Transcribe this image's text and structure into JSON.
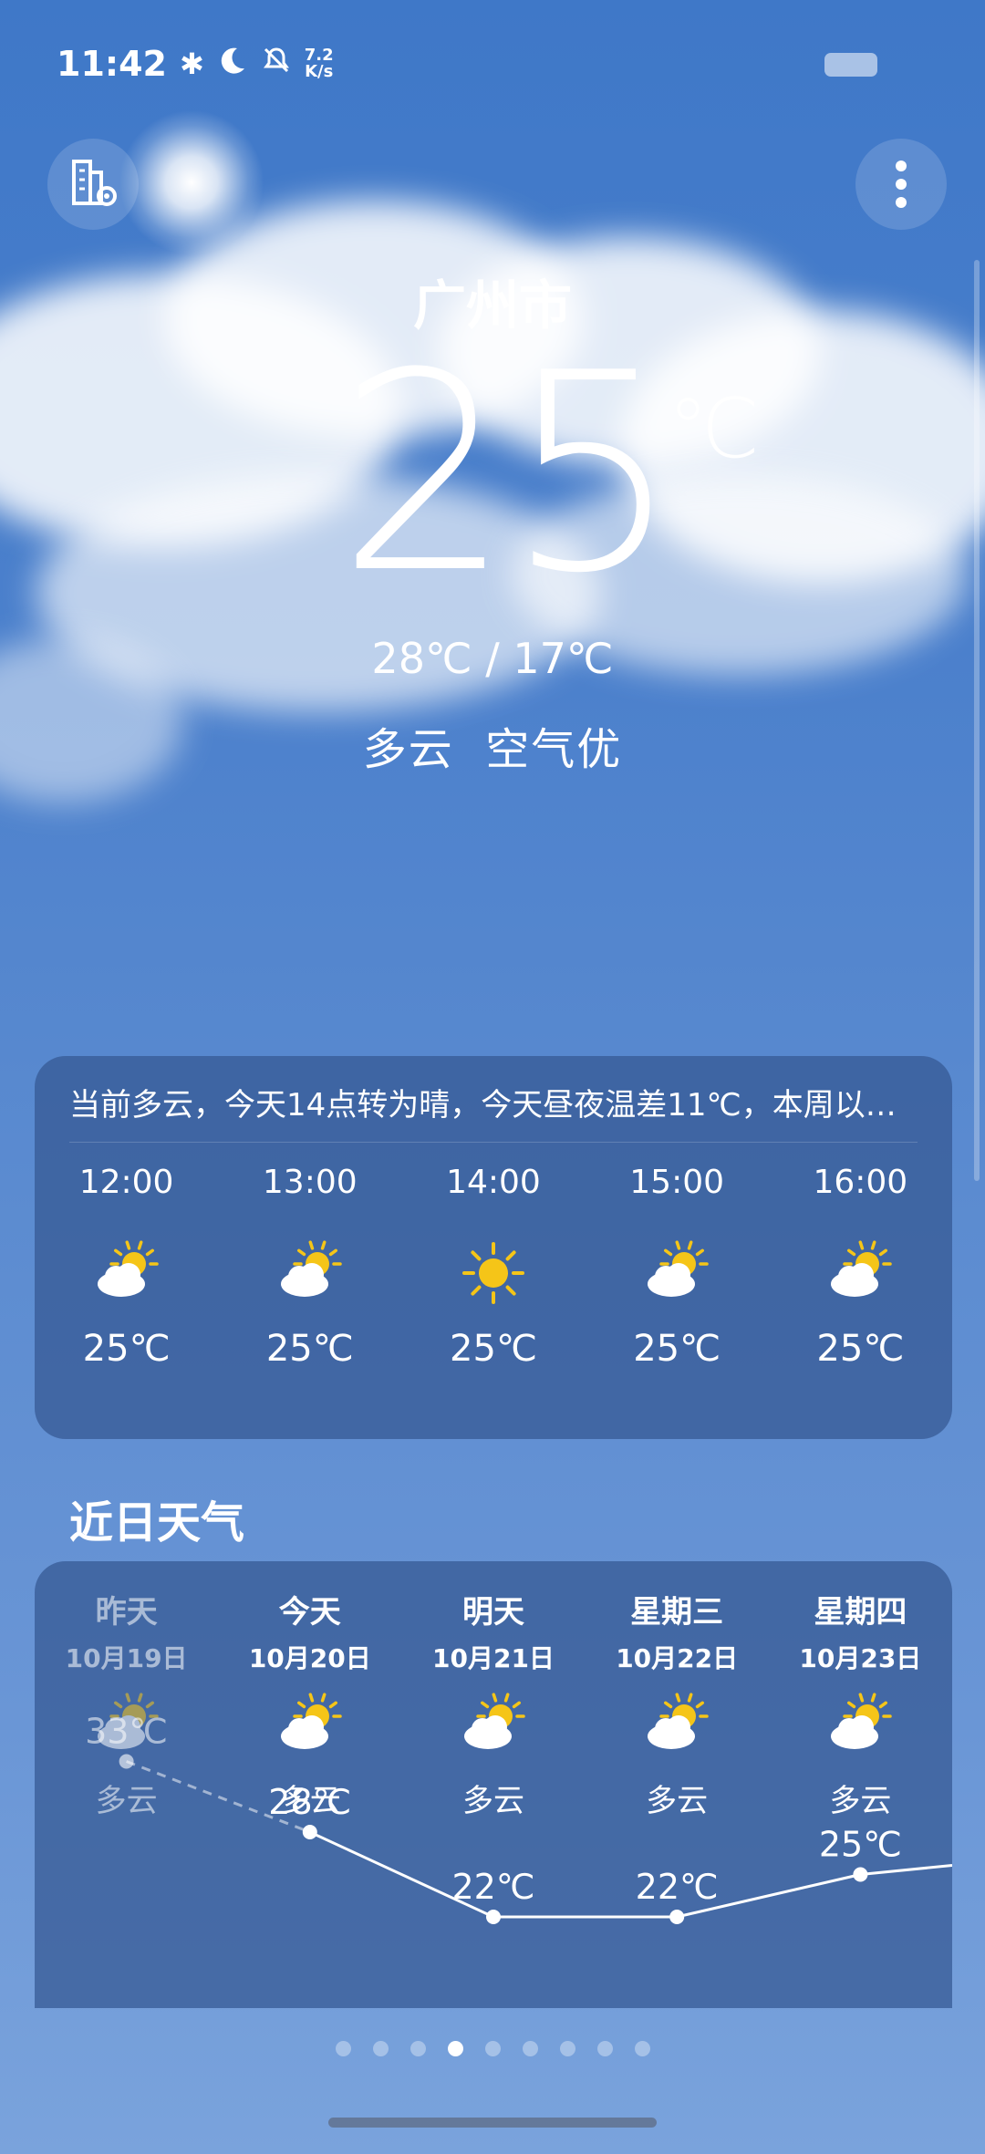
{
  "status_bar": {
    "time": "11:42",
    "net_top": "7.2",
    "net_bottom": "K/s"
  },
  "header": {
    "city": "广州市"
  },
  "current": {
    "temp": "25",
    "unit": "℃",
    "range": "28℃ / 17℃",
    "condition": "多云  空气优"
  },
  "forecast_card": {
    "summary": "当前多云，今天14点转为晴，今天昼夜温差11℃，本周以…",
    "hours": [
      {
        "time": "12:00",
        "icon": "partly-cloudy-icon",
        "temp": "25℃"
      },
      {
        "time": "13:00",
        "icon": "partly-cloudy-icon",
        "temp": "25℃"
      },
      {
        "time": "14:00",
        "icon": "sunny-icon",
        "temp": "25℃"
      },
      {
        "time": "15:00",
        "icon": "partly-cloudy-icon",
        "temp": "25℃"
      },
      {
        "time": "16:00",
        "icon": "partly-cloudy-icon",
        "temp": "25℃"
      }
    ]
  },
  "recent": {
    "title": "近日天气",
    "days": [
      {
        "name": "昨天",
        "date": "10月19日",
        "icon": "partly-cloudy-icon",
        "cond": "多云"
      },
      {
        "name": "今天",
        "date": "10月20日",
        "icon": "partly-cloudy-icon",
        "cond": "多云"
      },
      {
        "name": "明天",
        "date": "10月21日",
        "icon": "partly-cloudy-icon",
        "cond": "多云"
      },
      {
        "name": "星期三",
        "date": "10月22日",
        "icon": "partly-cloudy-icon",
        "cond": "多云"
      },
      {
        "name": "星期四",
        "date": "10月23日",
        "icon": "partly-cloudy-icon",
        "cond": "多云"
      }
    ],
    "highs": [
      {
        "label": "33℃",
        "value": 33
      },
      {
        "label": "28℃",
        "value": 28
      },
      {
        "label": "22℃",
        "value": 22
      },
      {
        "label": "22℃",
        "value": 22
      },
      {
        "label": "25℃",
        "value": 25
      }
    ]
  },
  "pager": {
    "count": 9,
    "active": 3
  },
  "colors": {
    "sun": "#f5c518",
    "cloud": "#ffffff"
  }
}
